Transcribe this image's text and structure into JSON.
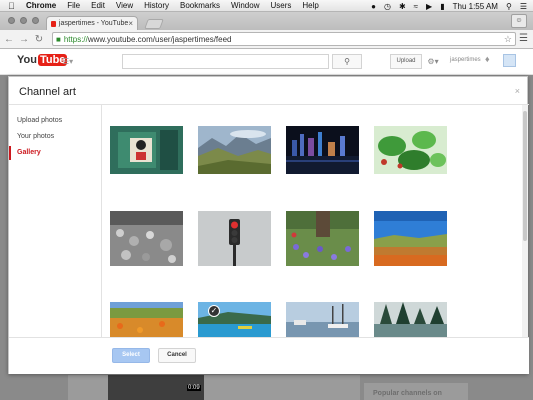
{
  "menubar": {
    "items": [
      "Chrome",
      "File",
      "Edit",
      "View",
      "History",
      "Bookmarks",
      "Window",
      "Users",
      "Help"
    ],
    "clock": "Thu 1:55 AM"
  },
  "browser": {
    "tab_title": "jaspertimes - YouTube",
    "url_scheme": "https://",
    "url_rest": "www.youtube.com/user/jaspertimes/feed"
  },
  "youtube": {
    "logo_you": "You",
    "logo_tube": "Tube",
    "upload_label": "Upload",
    "username": "jaspertimes"
  },
  "background": {
    "video_duration": "0:09",
    "side_heading": "Popular channels on"
  },
  "modal": {
    "title": "Channel art",
    "close": "×",
    "sidebar": [
      {
        "label": "Upload photos",
        "active": false
      },
      {
        "label": "Your photos",
        "active": false
      },
      {
        "label": "Gallery",
        "active": true
      }
    ],
    "select_label": "Select",
    "cancel_label": "Cancel",
    "selected_index": 8
  },
  "colors": {
    "accent": "#cc181e",
    "youtube_red": "#e62117",
    "select_disabled": "#a7c7f2"
  }
}
